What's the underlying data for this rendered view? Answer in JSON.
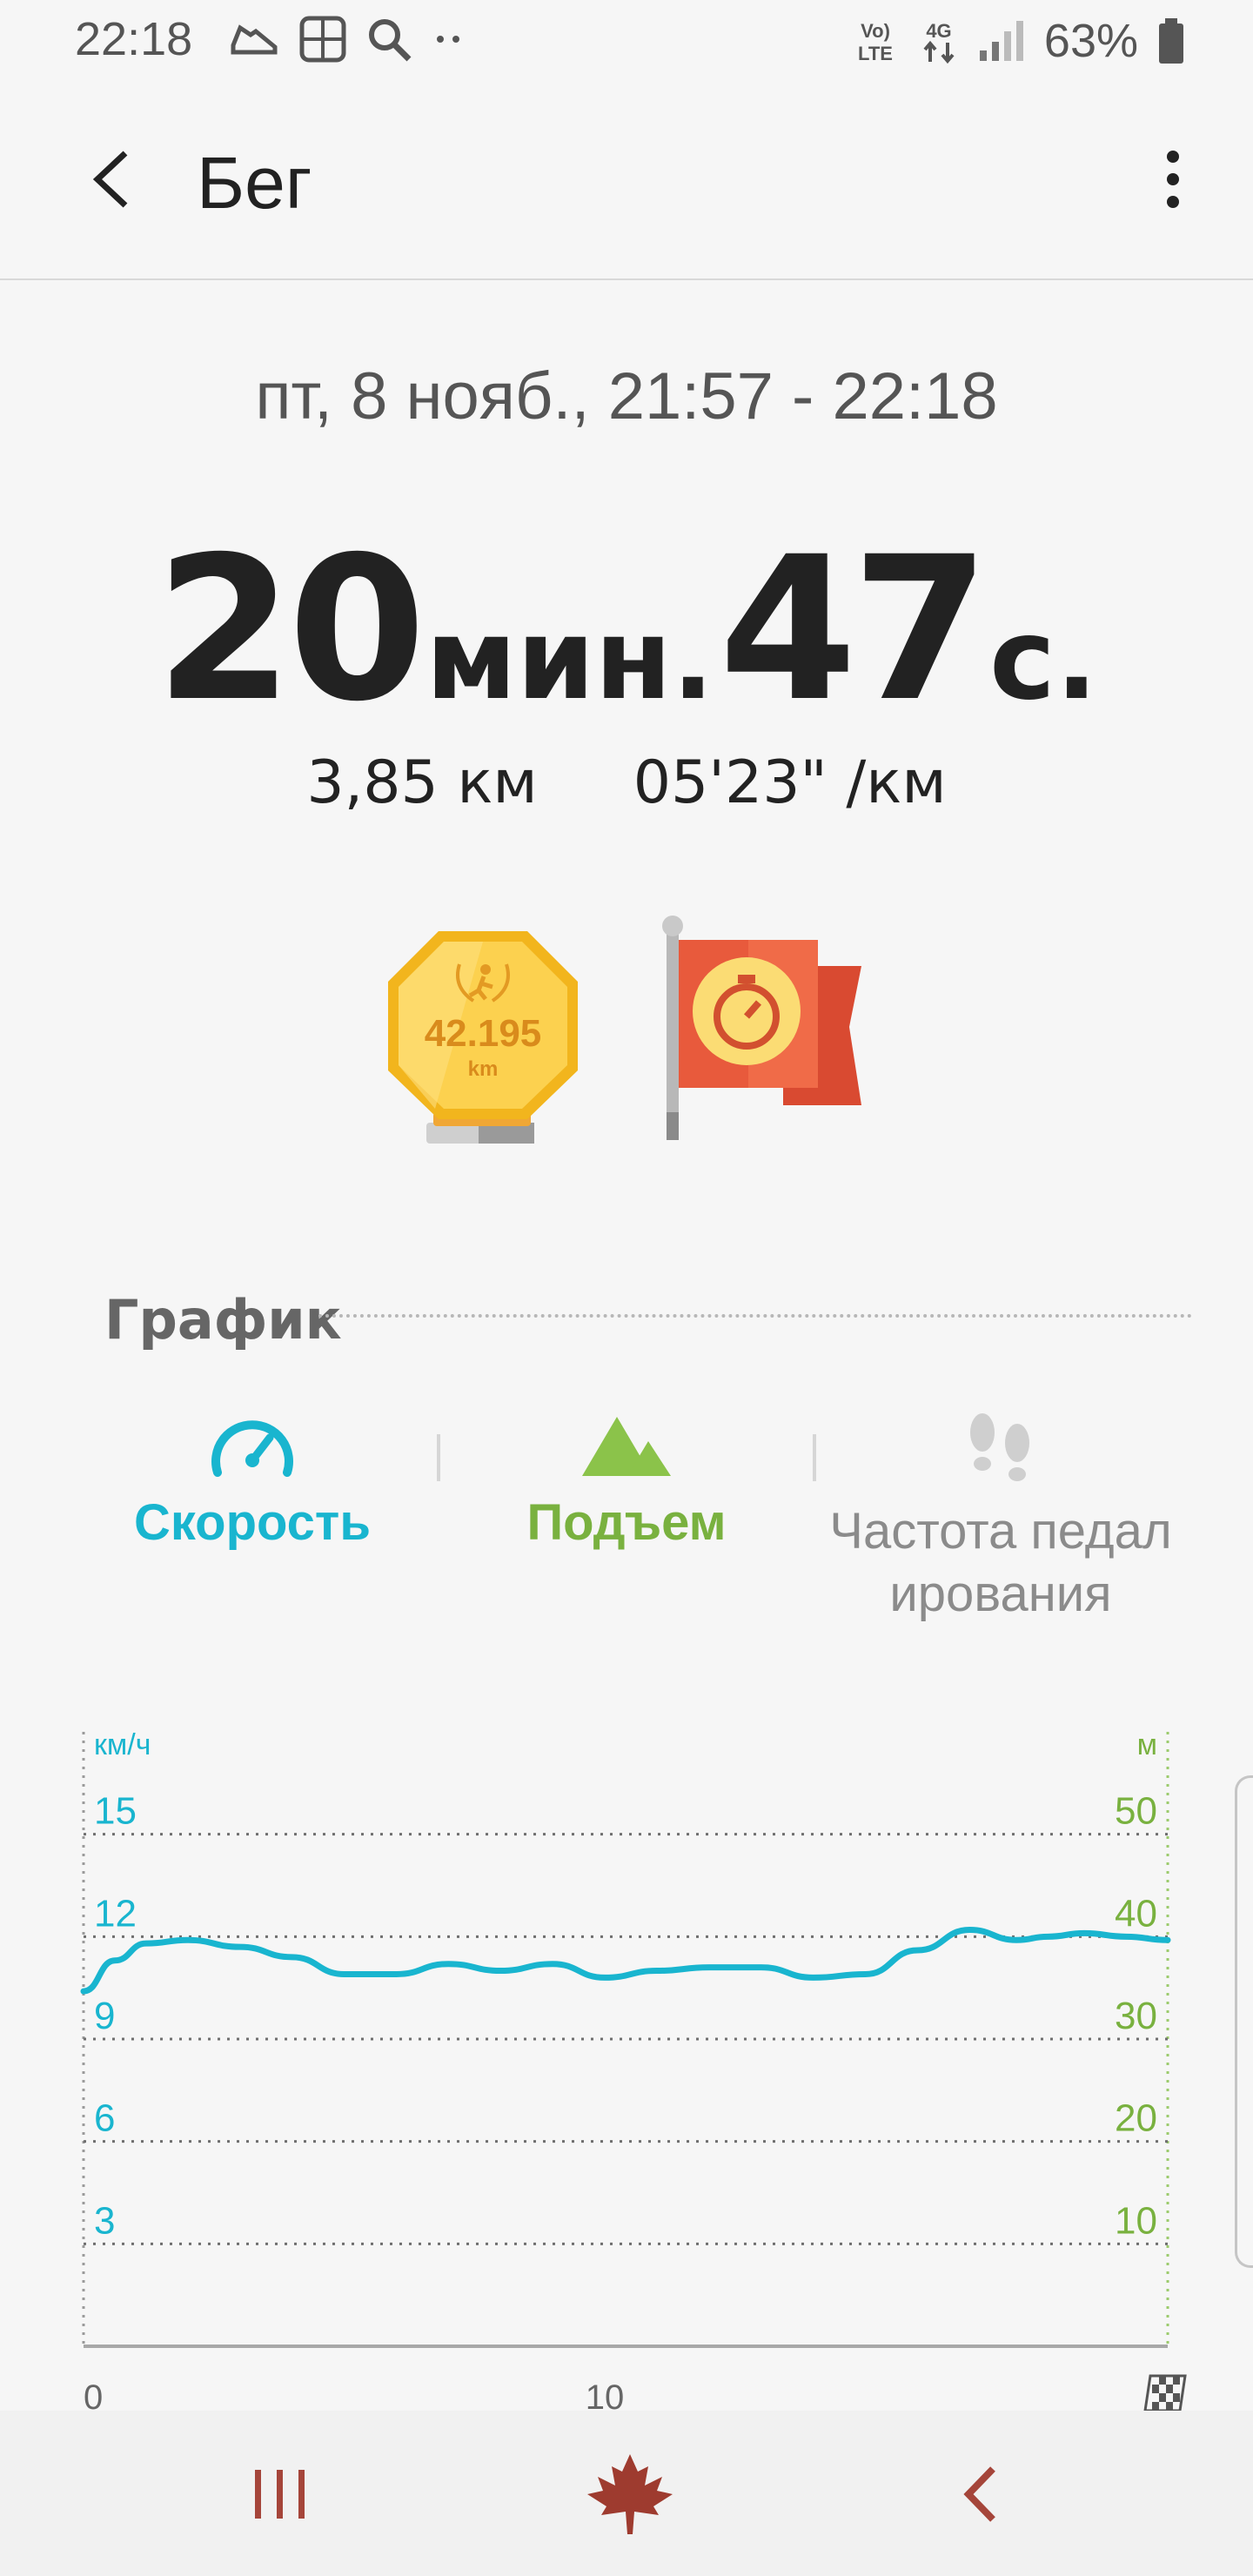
{
  "status_bar": {
    "time": "22:18",
    "battery_percent": "63%",
    "network_text": "Vo) LTE",
    "network_type": "4G",
    "icons_left": [
      "shoe-icon",
      "grid-icon",
      "search-icon",
      "more-dots-icon"
    ],
    "icons_right": [
      "volte-icon",
      "4g-icon",
      "signal-icon",
      "battery-icon"
    ]
  },
  "app_bar": {
    "title": "Бег",
    "back_icon": "arrow-left-icon",
    "more_icon": "more-vert-icon"
  },
  "workout": {
    "date_range": "пт, 8 нояб., 21:57 - 22:18",
    "duration_minutes": "20",
    "duration_minutes_unit": "мин.",
    "duration_seconds": "47",
    "duration_seconds_unit": "с.",
    "distance": "3,85 км",
    "pace": "05'23\" /км"
  },
  "badges": {
    "medal_value": "42.195",
    "medal_unit": "km",
    "flag_icon": "stopwatch-icon"
  },
  "section": {
    "title": "График"
  },
  "tabs": [
    {
      "label": "Скорость",
      "icon": "speedometer-icon",
      "color": "#19b5cf"
    },
    {
      "label": "Подъем",
      "icon": "mountain-icon",
      "color": "#79b13f"
    },
    {
      "label": "Частота педал ирования",
      "icon": "footsteps-icon",
      "color": "#8b8b8b"
    }
  ],
  "chart_data": {
    "type": "line",
    "left_axis_unit": "км/ч",
    "right_axis_unit": "м",
    "left_ticks": [
      "15",
      "12",
      "9",
      "6",
      "3"
    ],
    "right_ticks": [
      "50",
      "40",
      "30",
      "20",
      "10"
    ],
    "x_ticks": [
      "0",
      "10"
    ],
    "finish_icon": "checkered-flag-icon",
    "grid": true,
    "ylim_left": [
      0,
      18
    ],
    "ylim_right": [
      0,
      60
    ],
    "xlim": [
      0,
      20.8
    ],
    "series": [
      {
        "axis": "left",
        "color": "#19b5cf",
        "x": [
          0,
          0.6,
          1.2,
          2.0,
          3.0,
          4.0,
          5.0,
          6.0,
          7.0,
          8.0,
          9.0,
          10.0,
          11.0,
          12.0,
          13.0,
          14.0,
          15.0,
          16.0,
          17.0,
          17.9,
          18.5,
          19.2,
          20.0,
          20.8
        ],
        "y": [
          10.4,
          11.3,
          11.8,
          11.9,
          11.7,
          11.4,
          10.9,
          10.9,
          11.2,
          11.0,
          11.2,
          10.8,
          11.0,
          11.1,
          11.1,
          10.8,
          10.9,
          11.6,
          12.2,
          11.9,
          12.0,
          12.1,
          12.0,
          11.9
        ]
      }
    ]
  },
  "navbar": {
    "recent_icon": "recent-apps-icon",
    "home_icon": "maple-leaf-icon",
    "back_icon": "nav-back-icon"
  }
}
